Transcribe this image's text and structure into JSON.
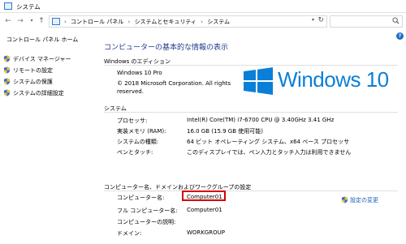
{
  "window": {
    "title": "システム"
  },
  "address": {
    "crumbs": [
      "コントロール パネル",
      "システムとセキュリティ",
      "システム"
    ],
    "search_placeholder": ""
  },
  "sidebar": {
    "home": "コントロール パネル ホーム",
    "items": [
      "デバイス マネージャー",
      "リモートの設定",
      "システムの保護",
      "システムの詳細設定"
    ]
  },
  "main": {
    "heading": "コンピューターの基本的な情報の表示",
    "edition": {
      "title": "Windows のエディション",
      "name": "Windows 10 Pro",
      "copyright_line1": "© 2018 Microsoft Corporation. All rights",
      "copyright_line2": "reserved.",
      "logo_text": "Windows 10"
    },
    "system": {
      "title": "システム",
      "rows": [
        {
          "label": "プロセッサ:",
          "value": "Intel(R) Core(TM) i7-6700 CPU @ 3.40GHz   3.41 GHz"
        },
        {
          "label": "実装メモリ (RAM):",
          "value": "16.0 GB (15.9 GB 使用可能)"
        },
        {
          "label": "システムの種類:",
          "value": "64 ビット オペレーティング システム、x64 ベース プロセッサ"
        },
        {
          "label": "ペンとタッチ:",
          "value": "このディスプレイでは、ペン入力とタッチ入力は利用できません"
        }
      ]
    },
    "computer": {
      "title": "コンピューター名、ドメインおよびワークグループの設定",
      "rows": [
        {
          "label": "コンピューター名:",
          "value": "Computer01"
        },
        {
          "label": "フル コンピューター名:",
          "value": "Computer01"
        },
        {
          "label": "コンピューターの説明:",
          "value": ""
        },
        {
          "label": "ドメイン:",
          "value": "WORKGROUP"
        }
      ],
      "change_link": "設定の変更"
    }
  },
  "colors": {
    "heading": "#1e3a8a",
    "highlight": "#d60000",
    "logo": "#0a7fd8",
    "link": "#1a5fb4"
  }
}
